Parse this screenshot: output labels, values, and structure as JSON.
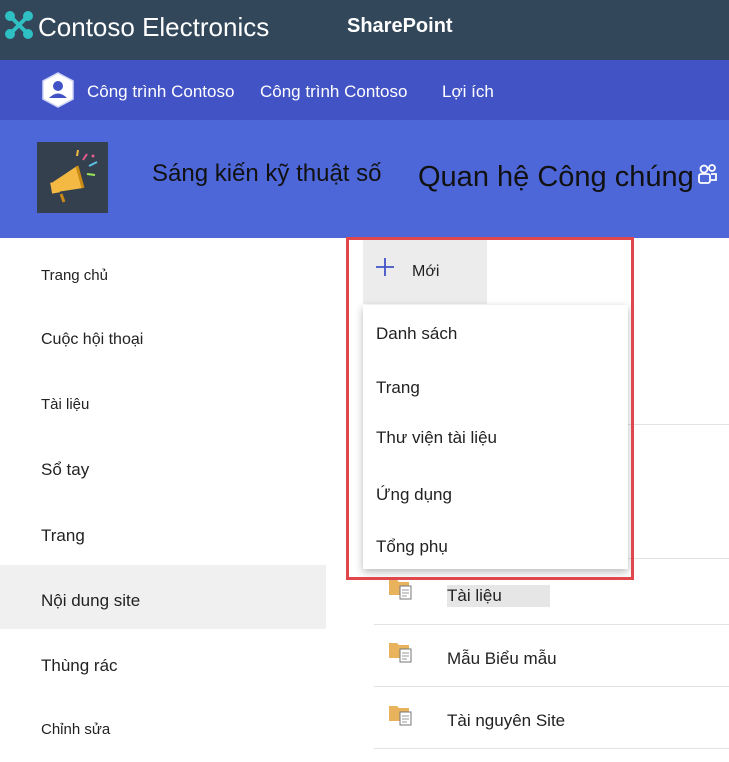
{
  "suite_bar": {
    "org_name": "Contoso Electronics",
    "product_name": "SharePoint"
  },
  "hub_nav": {
    "logo_icon": "person-shield-icon",
    "links": [
      "Công trình Contoso",
      "Công trình Contoso",
      "Lợi ích"
    ]
  },
  "site_header": {
    "logo_icon": "megaphone-icon",
    "title_primary": "Sáng kiến kỹ thuật số",
    "title_secondary": "Quan hệ Công chúng",
    "teams_icon": "teams-icon"
  },
  "left_nav": {
    "items": [
      {
        "label": "Trang chủ",
        "selected": false
      },
      {
        "label": "Cuộc hội thoại",
        "selected": false
      },
      {
        "label": "Tài liệu",
        "selected": false
      },
      {
        "label": "Sổ tay",
        "selected": false
      },
      {
        "label": "Trang",
        "selected": false
      },
      {
        "label": "Nội dung site",
        "selected": true
      },
      {
        "label": "Thùng rác",
        "selected": false
      },
      {
        "label": "Chỉnh sửa",
        "selected": false
      }
    ]
  },
  "command_bar": {
    "new_label": "Mới",
    "new_icon": "plus-icon"
  },
  "new_menu": {
    "items": [
      "Danh sách",
      "Trang",
      "Thư viện tài liệu",
      "Ứng dụng",
      "Tổng phụ"
    ]
  },
  "contents": {
    "rows": [
      {
        "label": "Tài liệu",
        "icon": "document-library-icon"
      },
      {
        "label": "Mẫu Biểu mẫu",
        "icon": "document-library-icon"
      },
      {
        "label": "Tài nguyên Site",
        "icon": "document-library-icon"
      }
    ]
  },
  "colors": {
    "suite_bar": "#33475b",
    "hub_nav": "#4253c6",
    "site_header": "#4d67d8",
    "highlight_border": "#e0474c"
  }
}
